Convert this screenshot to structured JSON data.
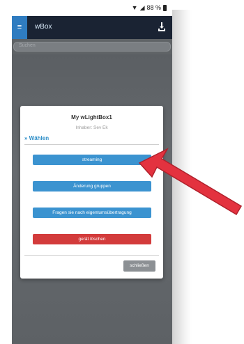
{
  "statusbar": {
    "battery_text": "88 %"
  },
  "appbar": {
    "menu_glyph": "≡",
    "title": "wBox"
  },
  "search": {
    "placeholder": "Suchen"
  },
  "dialog": {
    "title": "My wLightBox1",
    "owner": "Inhaber: Sev Ek",
    "choose": "» Wählen",
    "buttons": [
      "streaming",
      "Änderung gruppen",
      "Fragen sie nach eigentumsübertragung",
      "gerät löschen"
    ],
    "close_label": "schließen"
  },
  "colors": {
    "appbar": "#1a2333",
    "accent_blue": "#3b93d0",
    "danger_red": "#d33b3b",
    "arrow_red": "#e3323f"
  }
}
